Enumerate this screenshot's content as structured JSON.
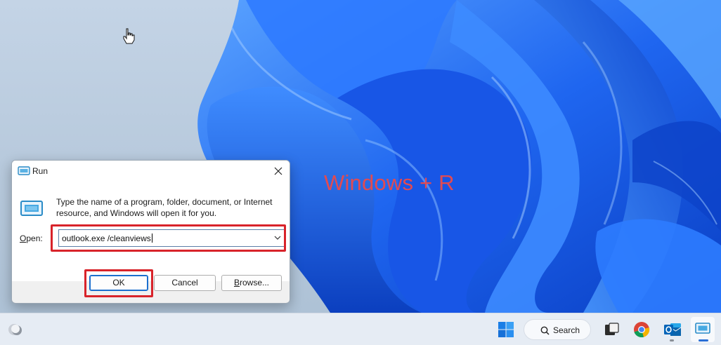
{
  "annotation": {
    "text": "Windows + R"
  },
  "run_dialog": {
    "title": "Run",
    "description": "Type the name of a program, folder, document, or Internet resource, and Windows will open it for you.",
    "open_label_prefix": "",
    "open_label_key": "O",
    "open_label_rest": "pen:",
    "open_value": "outlook.exe /cleanviews",
    "ok_label": "OK",
    "cancel_label": "Cancel",
    "browse_label_key": "B",
    "browse_label_rest": "rowse..."
  },
  "taskbar": {
    "search_label": "Search",
    "items": [
      "weather-icon",
      "start-icon",
      "search-icon",
      "task-view-icon",
      "chrome-icon",
      "outlook-icon",
      "run-icon"
    ]
  },
  "colors": {
    "highlight": "#d8232a",
    "annotation": "#e24a52",
    "wallpaper_blue": "#1e63e8",
    "accent": "#1b6fce"
  }
}
